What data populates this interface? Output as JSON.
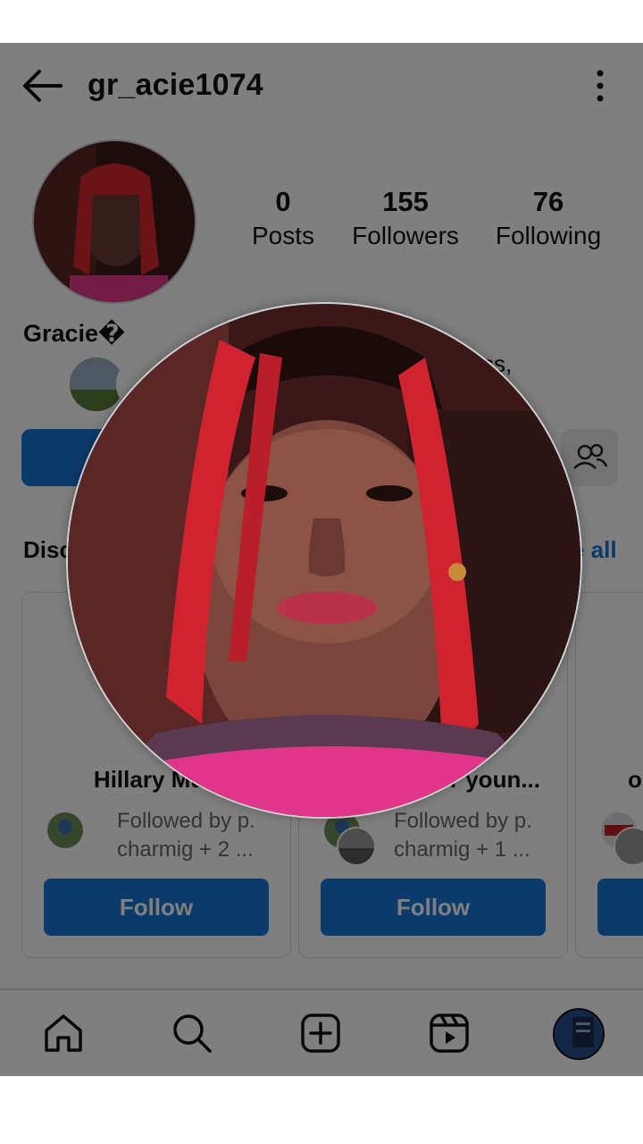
{
  "header": {
    "username": "gr_acie1074",
    "back_icon": "arrow-left-icon",
    "more_icon": "more-vertical-icon"
  },
  "profile": {
    "display_name": "Gracie�",
    "stats": [
      {
        "value": "0",
        "label": "Posts"
      },
      {
        "value": "155",
        "label": "Followers"
      },
      {
        "value": "76",
        "label": "Following"
      }
    ],
    "mutual_text_partial": "ss,"
  },
  "discover": {
    "title_partial": "Disc",
    "see_all_partial": "e all"
  },
  "suggestions": [
    {
      "name": "Hillary Mun",
      "followed_by": "Followed by p. charmig + 2 ...",
      "follow_label": "Follow"
    },
    {
      "name": "er youn...",
      "followed_by": "Followed by p. charmig + 1 ...",
      "follow_label": "Follow"
    },
    {
      "name": "o",
      "followed_by": "",
      "follow_label": ""
    }
  ],
  "bottom_nav": [
    {
      "icon": "home-icon"
    },
    {
      "icon": "search-icon"
    },
    {
      "icon": "plus-square-icon"
    },
    {
      "icon": "reels-icon"
    },
    {
      "icon": "profile-avatar"
    }
  ],
  "colors": {
    "accent": "#1877d6",
    "overlay": "rgba(0,0,0,0.5)"
  }
}
